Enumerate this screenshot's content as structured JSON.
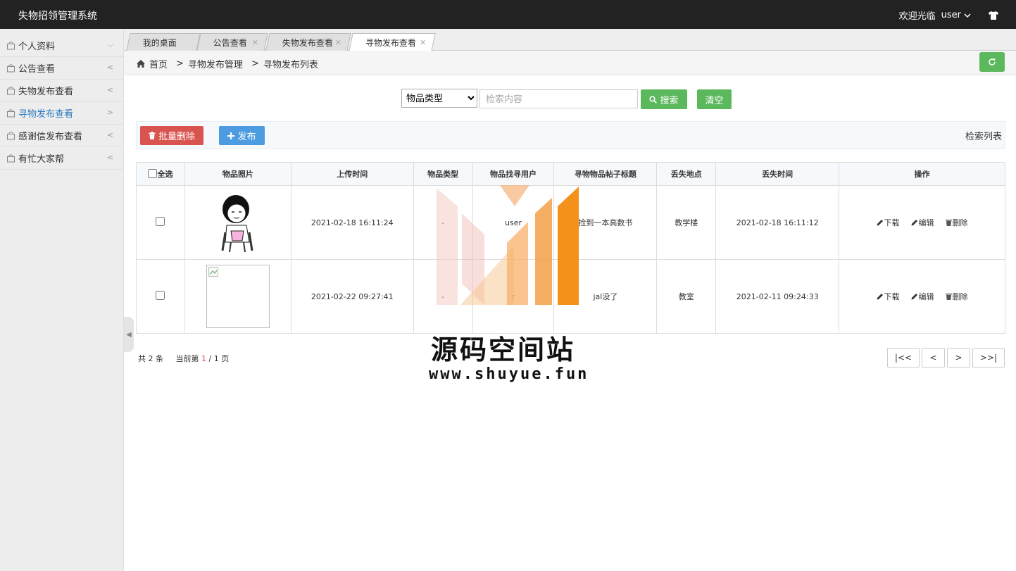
{
  "app": {
    "title": "失物招领管理系统",
    "welcome": "欢迎光临",
    "username": "user"
  },
  "sidebar": {
    "items": [
      {
        "label": "个人资料",
        "chevron": "⌵"
      },
      {
        "label": "公告查看",
        "chevron": "<"
      },
      {
        "label": "失物发布查看",
        "chevron": "<"
      },
      {
        "label": "寻物发布查看",
        "chevron": ">"
      },
      {
        "label": "感谢信发布查看",
        "chevron": "<"
      },
      {
        "label": "有忙大家帮",
        "chevron": "<"
      }
    ],
    "active_index": 3
  },
  "tabs": [
    {
      "label": "我的桌面"
    },
    {
      "label": "公告查看"
    },
    {
      "label": "失物发布查看"
    },
    {
      "label": "寻物发布查看"
    }
  ],
  "breadcrumb": {
    "home": "首页",
    "level1": "寻物发布管理",
    "level2": "寻物发布列表"
  },
  "search": {
    "type_selected": "物品类型",
    "placeholder": "检索内容",
    "search_label": "搜索",
    "clear_label": "清空"
  },
  "toolbar": {
    "batch_delete_label": "批量删除",
    "publish_label": "发布",
    "list_title": "检索列表"
  },
  "table": {
    "headers": [
      "全选",
      "物品照片",
      "上传时间",
      "物品类型",
      "物品找寻用户",
      "寻物物品帖子标题",
      "丢失地点",
      "丢失时间",
      "操作"
    ],
    "rows": [
      {
        "upload_time": "2021-02-18 16:11:24",
        "type": "-",
        "user": "user",
        "title": "捡到一本高数书",
        "place": "教学楼",
        "lost_time": "2021-02-18 16:11:12"
      },
      {
        "upload_time": "2021-02-22 09:27:41",
        "type": "-",
        "user": "r",
        "title": "jal没了",
        "place": "教室",
        "lost_time": "2021-02-11 09:24:33"
      }
    ],
    "ops": {
      "download": "下载",
      "edit": "编辑",
      "delete": "删除"
    }
  },
  "pagination": {
    "total_prefix": "共",
    "total": "2",
    "total_suffix": "条",
    "current_prefix": "当前第",
    "current": "1",
    "sep": "/",
    "pages": "1",
    "pages_suffix": "页",
    "first": "|<<",
    "prev": "<",
    "next": ">",
    "last": ">>|"
  },
  "watermark": {
    "title": "源码空间站",
    "url": "www.shuyue.fun"
  },
  "colors": {
    "header_bg": "#222222",
    "active_link": "#2d7cc0",
    "green": "#5cb85c",
    "red": "#d9534f",
    "blue": "#4d9be0",
    "watermark_orange": "#f5a04a"
  }
}
